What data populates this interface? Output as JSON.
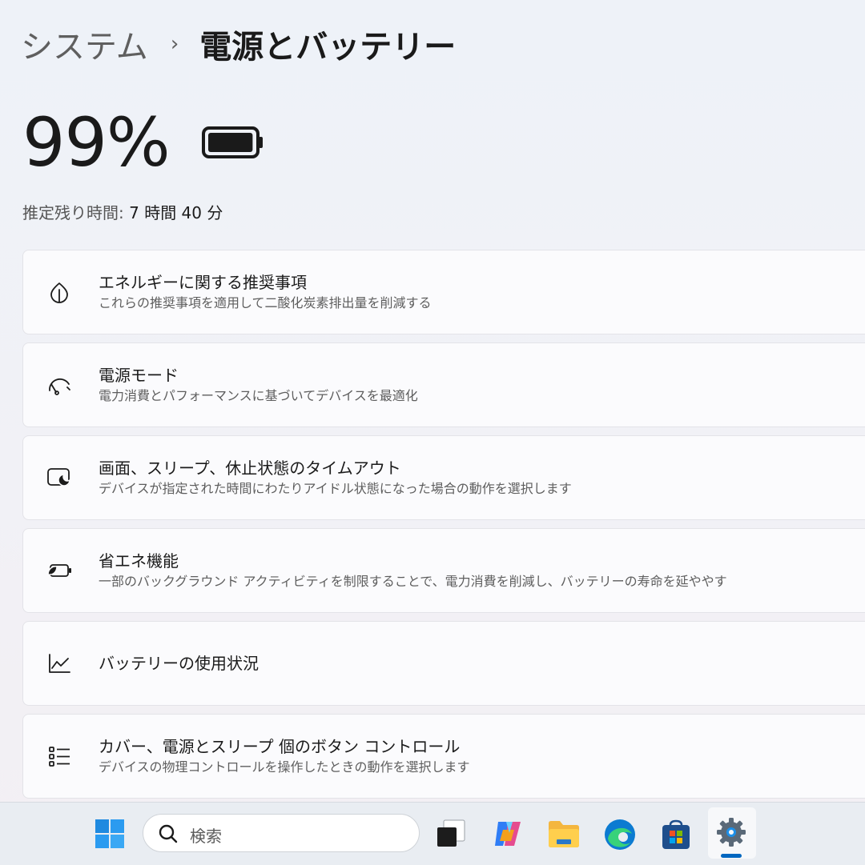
{
  "breadcrumb": {
    "parent": "システム",
    "separator": "›",
    "current": "電源とバッテリー"
  },
  "battery": {
    "percent_label": "99%",
    "level": 0.99,
    "estimate_label": "推定残り時間:",
    "estimate_value": "7 時間 40 分"
  },
  "cards": [
    {
      "icon": "leaf-icon",
      "title": "エネルギーに関する推奨事項",
      "subtitle": "これらの推奨事項を適用して二酸化炭素排出量を削減する"
    },
    {
      "icon": "gauge-icon",
      "title": "電源モード",
      "subtitle": "電力消費とパフォーマンスに基づいてデバイスを最適化"
    },
    {
      "icon": "screen-sleep-icon",
      "title": "画面、スリープ、休止状態のタイムアウト",
      "subtitle": "デバイスが指定された時間にわたりアイドル状態になった場合の動作を選択します"
    },
    {
      "icon": "battery-saver-icon",
      "title": "省エネ機能",
      "subtitle": "一部のバックグラウンド アクティビティを制限することで、電力消費を削減し、バッテリーの寿命を延ややす"
    },
    {
      "icon": "chart-line-icon",
      "title": "バッテリーの使用状況",
      "subtitle": ""
    },
    {
      "icon": "list-icon",
      "title": "カバー、電源とスリープ 個のボタン コントロール",
      "subtitle": "デバイスの物理コントロールを操作したときの動作を選択します"
    }
  ],
  "taskbar": {
    "search_placeholder": "検索",
    "items": [
      "start-icon",
      "search-icon",
      "task-view-icon",
      "copilot-icon",
      "file-explorer-icon",
      "edge-icon",
      "store-icon",
      "settings-icon"
    ],
    "accent": "#0067c0"
  }
}
